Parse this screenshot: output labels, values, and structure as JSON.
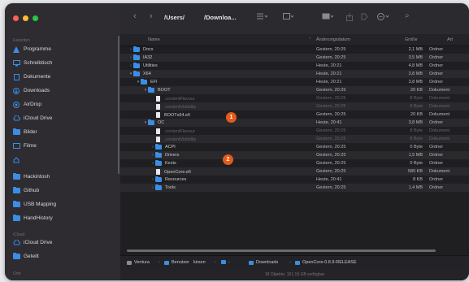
{
  "window": {
    "traffic_lights": {
      "close": "#ff5f57",
      "minimize": "#febc2e",
      "zoom": "#28c840"
    }
  },
  "sidebar": {
    "section_favorites": "Favoriten",
    "favorites": [
      {
        "label": "Programme",
        "icon": "apps-icon"
      },
      {
        "label": "Schreibtisch",
        "icon": "desktop-icon"
      },
      {
        "label": "Dokumente",
        "icon": "document-icon"
      },
      {
        "label": "Downloads",
        "icon": "download-icon"
      },
      {
        "label": "AirDrop",
        "icon": "airdrop-icon"
      },
      {
        "label": "iCloud Drive",
        "icon": "cloud-icon"
      },
      {
        "label": "Bilder",
        "icon": "photos-icon"
      },
      {
        "label": "Filme",
        "icon": "movie-icon"
      },
      {
        "label": "",
        "icon": "home-icon"
      },
      {
        "label": "Hackintosh",
        "icon": "folder-icon"
      },
      {
        "label": "Github",
        "icon": "folder-icon"
      },
      {
        "label": "USB Mapping",
        "icon": "folder-icon"
      },
      {
        "label": "HandHistory",
        "icon": "folder-icon"
      }
    ],
    "section_icloud": "iCloud",
    "icloud": [
      {
        "label": "iCloud Drive",
        "icon": "cloud-icon"
      },
      {
        "label": "Geteilt",
        "icon": "shared-folder-icon"
      }
    ],
    "section_orte": "Orte"
  },
  "toolbar": {
    "back": "‹",
    "forward": "›",
    "path_users": "/Users/",
    "path_downloads": "/Downloa...",
    "search_icon": "⌕"
  },
  "columns": {
    "name": "Name",
    "date": "Änderungsdatum",
    "size": "Größe",
    "kind": "Art"
  },
  "rows": [
    {
      "indent": 0,
      "type": "folder",
      "expanded": false,
      "name": "Docs",
      "date": "Gestern, 20:25",
      "size": "2,1 MB",
      "kind": "Ordner"
    },
    {
      "indent": 0,
      "type": "folder",
      "expanded": false,
      "name": "IA32",
      "date": "Gestern, 20:25",
      "size": "3,5 MB",
      "kind": "Ordner"
    },
    {
      "indent": 0,
      "type": "folder",
      "expanded": false,
      "name": "Utilities",
      "date": "Heute, 20:21",
      "size": "4,8 MB",
      "kind": "Ordner"
    },
    {
      "indent": 0,
      "type": "folder",
      "expanded": true,
      "name": "X64",
      "date": "Heute, 20:21",
      "size": "3,8 MB",
      "kind": "Ordner"
    },
    {
      "indent": 1,
      "type": "folder",
      "expanded": true,
      "name": "EFI",
      "date": "Heute, 20:21",
      "size": "3,8 MB",
      "kind": "Ordner"
    },
    {
      "indent": 2,
      "type": "folder",
      "expanded": true,
      "name": "BOOT",
      "date": "Gestern, 20:25",
      "size": "20 KB",
      "kind": "Dokument"
    },
    {
      "indent": 3,
      "type": "file",
      "dim": true,
      "name": ".contentFlavour",
      "date": "Gestern, 20:25",
      "size": "8 Byte",
      "kind": "Dokument"
    },
    {
      "indent": 3,
      "type": "file",
      "dim": true,
      "name": ".contentVisibility",
      "date": "Gestern, 20:25",
      "size": "8 Byte",
      "kind": "Dokument"
    },
    {
      "indent": 3,
      "type": "file",
      "name": "BOOTx64.efi",
      "date": "Gestern, 20:25",
      "size": "20 KB",
      "kind": "Dokument"
    },
    {
      "indent": 2,
      "type": "folder",
      "expanded": true,
      "name": "OC",
      "date": "Heute, 20:41",
      "size": "3,8 MB",
      "kind": "Ordner"
    },
    {
      "indent": 3,
      "type": "file",
      "dim": true,
      "name": ".contentFlavour",
      "date": "Gestern, 20:25",
      "size": "8 Byte",
      "kind": "Dokument"
    },
    {
      "indent": 3,
      "type": "file",
      "dim": true,
      "name": ".contentVisibility",
      "date": "Gestern, 20:25",
      "size": "8 Byte",
      "kind": "Dokument"
    },
    {
      "indent": 3,
      "type": "folder",
      "expanded": false,
      "name": "ACPI",
      "date": "Gestern, 20:25",
      "size": "0 Byte",
      "kind": "Ordner"
    },
    {
      "indent": 3,
      "type": "folder",
      "expanded": false,
      "name": "Drivers",
      "date": "Gestern, 20:25",
      "size": "1,5 MB",
      "kind": "Ordner"
    },
    {
      "indent": 3,
      "type": "folder",
      "expanded": false,
      "name": "Kexts",
      "date": "Gestern, 20:25",
      "size": "0 Byte",
      "kind": "Ordner"
    },
    {
      "indent": 3,
      "type": "file",
      "name": "OpenCore.efi",
      "date": "Gestern, 20:25",
      "size": "580 KB",
      "kind": "Dokument"
    },
    {
      "indent": 3,
      "type": "folder",
      "expanded": false,
      "name": "Resources",
      "date": "Heute, 20:41",
      "size": "8 KB",
      "kind": "Ordner"
    },
    {
      "indent": 3,
      "type": "folder",
      "expanded": false,
      "name": "Tools",
      "date": "Gestern, 20:25",
      "size": "1,4 MB",
      "kind": "Ordner"
    }
  ],
  "badges": [
    "1",
    "2"
  ],
  "pathbar": {
    "segments": [
      "Ventura",
      "Benutzer",
      "kirsen",
      "",
      "Downloads",
      "OpenCore-0.8.9-RELEASE"
    ]
  },
  "status": "18 Objekte, 161,19 GB verfügbar",
  "colors": {
    "accent": "#3a8ee6",
    "badge": "#e55a1a",
    "sidebar_bg": "#2e2c31",
    "list_bg": "#1f1f22"
  }
}
